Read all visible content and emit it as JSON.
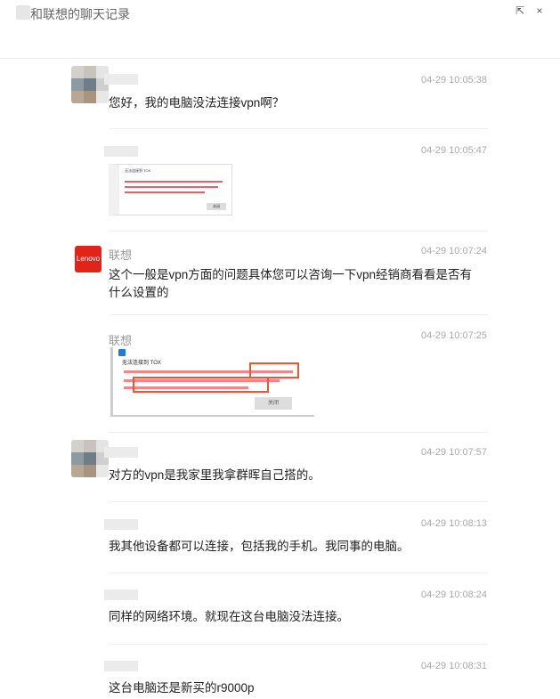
{
  "window": {
    "title": "和联想的聊天记录",
    "popout_icon": "⇱",
    "close_icon": "×"
  },
  "messages": [
    {
      "sender": "",
      "time": "04-29 10:05:38",
      "text": "您好，我的电脑没法连接vpn啊？"
    },
    {
      "sender": "",
      "time": "04-29 10:05:47",
      "image": "error-dialog-screenshot"
    },
    {
      "sender": "联想",
      "time": "04-29 10:07:24",
      "text": "这个一般是vpn方面的问题具体您可以咨询一下vpn经销商看看是否有什么设置的"
    },
    {
      "sender": "联想",
      "time": "04-29 10:07:25",
      "image": "annotated-error-screenshot"
    },
    {
      "sender": "",
      "time": "04-29 10:07:57",
      "text": "对方的vpn是我家里我拿群晖自己搭的。"
    },
    {
      "sender": "",
      "time": "04-29 10:08:13",
      "text": "我其他设备都可以连接，包括我的手机。我同事的电脑。"
    },
    {
      "sender": "",
      "time": "04-29 10:08:24",
      "text": "同样的网络环境。就现在这台电脑没法连接。"
    },
    {
      "sender": "",
      "time": "04-29 10:08:31",
      "text": "这台电脑还是新买的r9000p"
    }
  ],
  "avatars": {
    "lenovo_label": "Lenovo"
  },
  "screenshot1": {
    "heading": "无法连接到 TOX",
    "button": "关闭"
  },
  "screenshot2": {
    "heading": "无法连接到 TOX",
    "button": "关闭"
  }
}
